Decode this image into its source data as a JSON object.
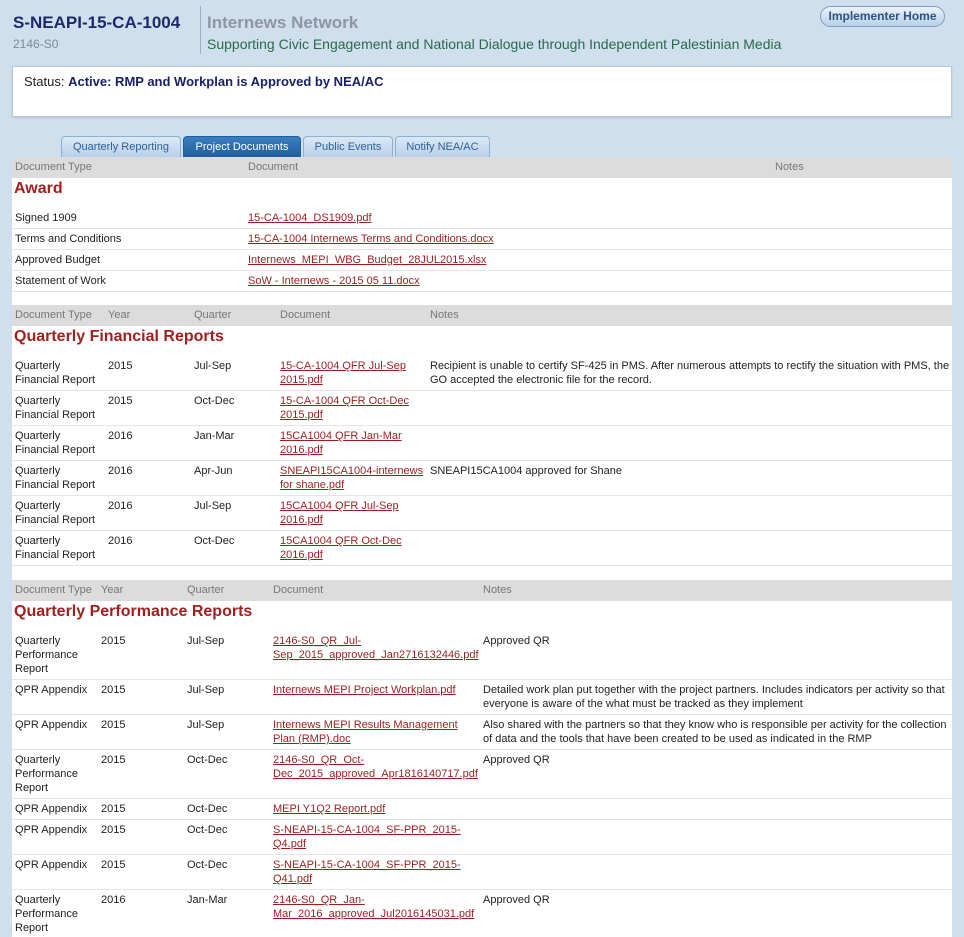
{
  "header": {
    "project_id": "S-NEAPI-15-CA-1004",
    "project_sub": "2146-S0",
    "org_name": "Internews Network",
    "org_tagline": "Supporting Civic Engagement and National Dialogue through Independent Palestinian Media",
    "home_button": "Implementer Home"
  },
  "status": {
    "label": "Status:",
    "value": "Active: RMP and Workplan is Approved by NEA/AC"
  },
  "tabs": [
    {
      "label": "Quarterly Reporting"
    },
    {
      "label": "Project Documents"
    },
    {
      "label": "Public Events"
    },
    {
      "label": "Notify NEA/AC"
    }
  ],
  "award": {
    "columns": [
      "Document Type",
      "Document",
      "Notes"
    ],
    "title": "Award",
    "rows": [
      {
        "type": "Signed 1909",
        "document": "15-CA-1004_DS1909.pdf",
        "notes": ""
      },
      {
        "type": "Terms and Conditions",
        "document": "15-CA-1004 Internews Terms and Conditions.docx",
        "notes": ""
      },
      {
        "type": "Approved Budget",
        "document": "Internews_MEPI_WBG_Budget_28JUL2015.xlsx",
        "notes": ""
      },
      {
        "type": "Statement of Work",
        "document": "SoW - Internews - 2015 05 11.docx",
        "notes": ""
      }
    ]
  },
  "qfr": {
    "columns": [
      "Document Type",
      "Year",
      "Quarter",
      "Document",
      "Notes"
    ],
    "title": "Quarterly Financial Reports",
    "rows": [
      {
        "type_l1": "Quarterly",
        "type_l2": "Financial Report",
        "year": "2015",
        "quarter": "Jul-Sep",
        "doc_l1": "15-CA-1004 QFR Jul-Sep",
        "doc_l2": "2015.pdf",
        "notes_l1": "Recipient is unable to certify SF-425 in PMS. After numerous attempts to rectify the situation with PMS, the",
        "notes_l2": "GO accepted the electronic file for the record."
      },
      {
        "type_l1": "Quarterly",
        "type_l2": "Financial Report",
        "year": "2015",
        "quarter": "Oct-Dec",
        "doc_l1": "15-CA-1004 QFR Oct-Dec",
        "doc_l2": "2015.pdf",
        "notes_l1": "",
        "notes_l2": ""
      },
      {
        "type_l1": "Quarterly",
        "type_l2": "Financial Report",
        "year": "2016",
        "quarter": "Jan-Mar",
        "doc_l1": "15CA1004 QFR Jan-Mar",
        "doc_l2": "2016.pdf",
        "notes_l1": "",
        "notes_l2": ""
      },
      {
        "type_l1": "Quarterly",
        "type_l2": "Financial Report",
        "year": "2016",
        "quarter": "Apr-Jun",
        "doc_l1": "SNEAPI15CA1004-internews",
        "doc_l2": "for shane.pdf",
        "notes_l1": "SNEAPI15CA1004 approved for Shane",
        "notes_l2": ""
      },
      {
        "type_l1": "Quarterly",
        "type_l2": "Financial Report",
        "year": "2016",
        "quarter": "Jul-Sep",
        "doc_l1": "15CA1004 QFR Jul-Sep",
        "doc_l2": "2016.pdf",
        "notes_l1": "",
        "notes_l2": ""
      },
      {
        "type_l1": "Quarterly",
        "type_l2": "Financial Report",
        "year": "2016",
        "quarter": "Oct-Dec",
        "doc_l1": "15CA1004 QFR Oct-Dec",
        "doc_l2": "2016.pdf",
        "notes_l1": "",
        "notes_l2": ""
      }
    ]
  },
  "qpr": {
    "columns": [
      "Document Type",
      "Year",
      "Quarter",
      "Document",
      "Notes"
    ],
    "title": "Quarterly Performance Reports",
    "rows": [
      {
        "type_l1": "Quarterly",
        "type_l2": "Performance",
        "type_l3": "Report",
        "year": "2015",
        "quarter": "Jul-Sep",
        "doc_l1": "2146-S0_QR_Jul-",
        "doc_l2": "Sep_2015_approved_Jan2716132446.pdf",
        "notes_l1": "Approved QR",
        "notes_l2": ""
      },
      {
        "type_l1": "QPR Appendix",
        "type_l2": "",
        "type_l3": "",
        "year": "2015",
        "quarter": "Jul-Sep",
        "doc_l1": "Internews MEPI Project Workplan.pdf",
        "doc_l2": "",
        "notes_l1": "Detailed work plan put together with the project partners. Includes indicators per activity so that",
        "notes_l2": "everyone is aware of the what must be tracked as they implement"
      },
      {
        "type_l1": "QPR Appendix",
        "type_l2": "",
        "type_l3": "",
        "year": "2015",
        "quarter": "Jul-Sep",
        "doc_l1": "Internews MEPI Results Management",
        "doc_l2": "Plan (RMP).doc",
        "notes_l1": "Also shared with the partners so that they know who is responsible per activity for the collection",
        "notes_l2": "of data and the tools that have been created to be used as indicated in the RMP"
      },
      {
        "type_l1": "Quarterly",
        "type_l2": "Performance",
        "type_l3": "Report",
        "year": "2015",
        "quarter": "Oct-Dec",
        "doc_l1": "2146-S0_QR_Oct-",
        "doc_l2": "Dec_2015_approved_Apr1816140717.pdf",
        "notes_l1": "Approved QR",
        "notes_l2": ""
      },
      {
        "type_l1": "QPR Appendix",
        "type_l2": "",
        "type_l3": "",
        "year": "2015",
        "quarter": "Oct-Dec",
        "doc_l1": "MEPI Y1Q2 Report.pdf",
        "doc_l2": "",
        "notes_l1": "",
        "notes_l2": ""
      },
      {
        "type_l1": "QPR Appendix",
        "type_l2": "",
        "type_l3": "",
        "year": "2015",
        "quarter": "Oct-Dec",
        "doc_l1": "S-NEAPI-15-CA-1004_SF-PPR_2015-",
        "doc_l2": "Q4.pdf",
        "notes_l1": "",
        "notes_l2": ""
      },
      {
        "type_l1": "QPR Appendix",
        "type_l2": "",
        "type_l3": "",
        "year": "2015",
        "quarter": "Oct-Dec",
        "doc_l1": "S-NEAPI-15-CA-1004_SF-PPR_2015-",
        "doc_l2": "Q41.pdf",
        "notes_l1": "",
        "notes_l2": ""
      },
      {
        "type_l1": "Quarterly",
        "type_l2": "Performance",
        "type_l3": "Report",
        "year": "2016",
        "quarter": "Jan-Mar",
        "doc_l1": "2146-S0_QR_Jan-",
        "doc_l2": "Mar_2016_approved_Jul2016145031.pdf",
        "notes_l1": "Approved QR",
        "notes_l2": ""
      }
    ]
  }
}
